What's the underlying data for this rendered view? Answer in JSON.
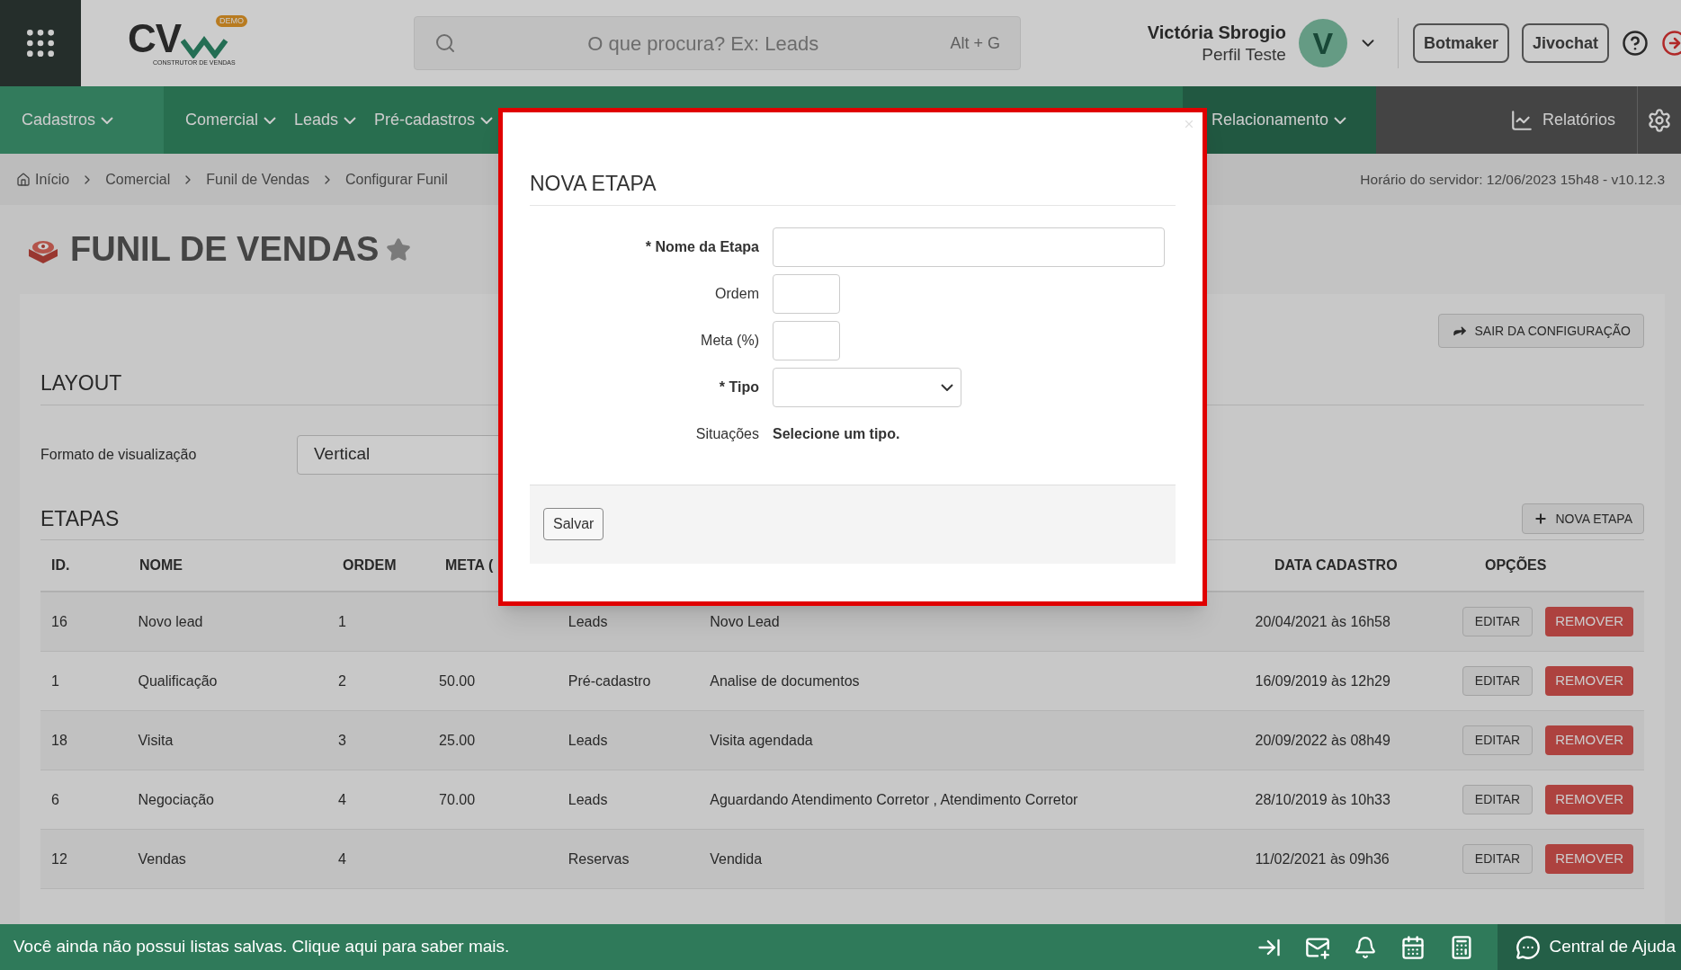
{
  "topbar": {
    "logo": {
      "text": "CV",
      "badge": "DEMO",
      "tagline": "CONSTRUTOR DE VENDAS"
    },
    "search": {
      "placeholder": "O que procura? Ex: Leads",
      "shortcut": "Alt + G"
    },
    "user": {
      "name": "Victória Sbrogio",
      "profile": "Perfil Teste",
      "avatar": "V"
    },
    "buttons": [
      "Botmaker",
      "Jivochat"
    ]
  },
  "nav": {
    "groups": [
      {
        "items": [
          "Cadastros"
        ]
      },
      {
        "items": [
          "Comercial",
          "Leads",
          "Pré-cadastros"
        ]
      },
      {
        "items": [
          "Relacionamento"
        ]
      }
    ],
    "reports": "Relatórios"
  },
  "breadcrumb": {
    "items": [
      "Início",
      "Comercial",
      "Funil de Vendas",
      "Configurar Funil"
    ],
    "server_time": "Horário do servidor: 12/06/2023 15h48 - v10.12.3"
  },
  "page": {
    "title": "FUNIL DE VENDAS",
    "exit_button": "SAIR DA CONFIGURAÇÃO",
    "layout": {
      "heading": "LAYOUT",
      "label": "Formato de visualização",
      "value": "Vertical"
    },
    "stages": {
      "heading": "ETAPAS",
      "new_button": "NOVA ETAPA"
    }
  },
  "table": {
    "columns": [
      "ID.",
      "NOME",
      "ORDEM",
      "META (",
      "",
      "",
      "DATA CADASTRO",
      "OPÇÕES"
    ],
    "rows": [
      {
        "cells": [
          "16",
          "Novo lead",
          "1",
          "",
          "Leads",
          "Novo Lead",
          "20/04/2021 às 16h58"
        ],
        "edit": "EDITAR",
        "remove": "REMOVER"
      },
      {
        "cells": [
          "1",
          "Qualificação",
          "2",
          "50.00",
          "Pré-cadastro",
          "Analise de documentos",
          "16/09/2019 às 12h29"
        ],
        "edit": "EDITAR",
        "remove": "REMOVER"
      },
      {
        "cells": [
          "18",
          "Visita",
          "3",
          "25.00",
          "Leads",
          "Visita agendada",
          "20/09/2022 às 08h49"
        ],
        "edit": "EDITAR",
        "remove": "REMOVER"
      },
      {
        "cells": [
          "6",
          "Negociação",
          "4",
          "70.00",
          "Leads",
          "Aguardando Atendimento Corretor , Atendimento Corretor",
          "28/10/2019 às 10h33"
        ],
        "edit": "EDITAR",
        "remove": "REMOVER"
      },
      {
        "cells": [
          "12",
          "Vendas",
          "4",
          "",
          "Reservas",
          "Vendida",
          "11/02/2021 às 09h36"
        ],
        "edit": "EDITAR",
        "remove": "REMOVER"
      }
    ]
  },
  "modal": {
    "title": "NOVA ETAPA",
    "fields": [
      {
        "label": "* Nome da Etapa",
        "required": true,
        "kind": "text"
      },
      {
        "label": "Ordem",
        "required": false,
        "kind": "short"
      },
      {
        "label": "Meta (%)",
        "required": false,
        "kind": "short"
      },
      {
        "label": "* Tipo",
        "required": true,
        "kind": "select"
      },
      {
        "label": "Situações",
        "required": false,
        "kind": "info",
        "value": "Selecione um tipo."
      }
    ],
    "save": "Salvar"
  },
  "footer": {
    "message": "Você ainda não possui listas salvas. Clique aqui para saber mais.",
    "help": "Central de Ajuda"
  }
}
